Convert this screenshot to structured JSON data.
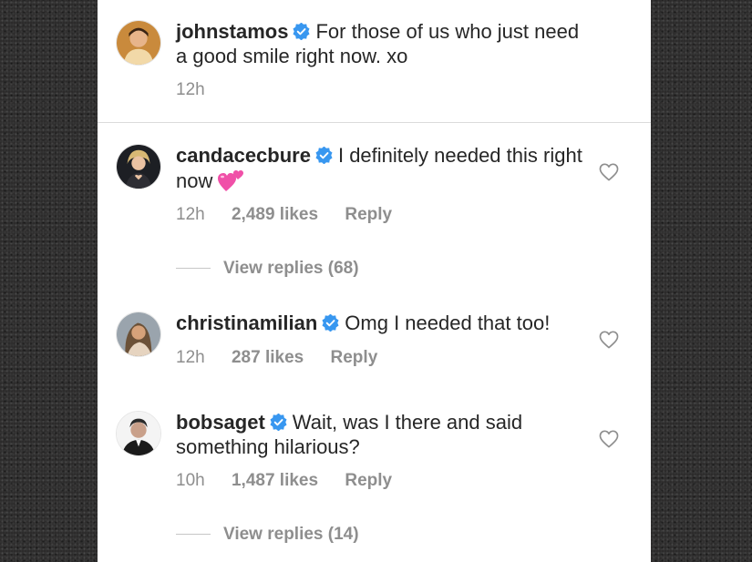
{
  "comments": [
    {
      "username": "johnstamos",
      "text": "For those of us who just need a good smile right now.  xo",
      "time": "12h"
    },
    {
      "username": "candacecbure",
      "text": "I definitely needed this right now",
      "emoji": "two-hearts-emoji",
      "time": "12h",
      "likes": "2,489 likes",
      "reply": "Reply",
      "view_replies": "View replies (68)"
    },
    {
      "username": "christinamilian",
      "text": "Omg I needed that too!",
      "time": "12h",
      "likes": "287 likes",
      "reply": "Reply"
    },
    {
      "username": "bobsaget",
      "text": "Wait, was I there and said something hilarious?",
      "time": "10h",
      "likes": "1,487 likes",
      "reply": "Reply",
      "view_replies": "View replies (14)"
    }
  ],
  "colors": {
    "verified_blue": "#3897f0",
    "meta_gray": "#8e8e8e",
    "text_dark": "#262626",
    "divider": "#dbdbdb"
  },
  "icons": {
    "verified": "verified-badge-icon",
    "like": "heart-outline-icon"
  }
}
